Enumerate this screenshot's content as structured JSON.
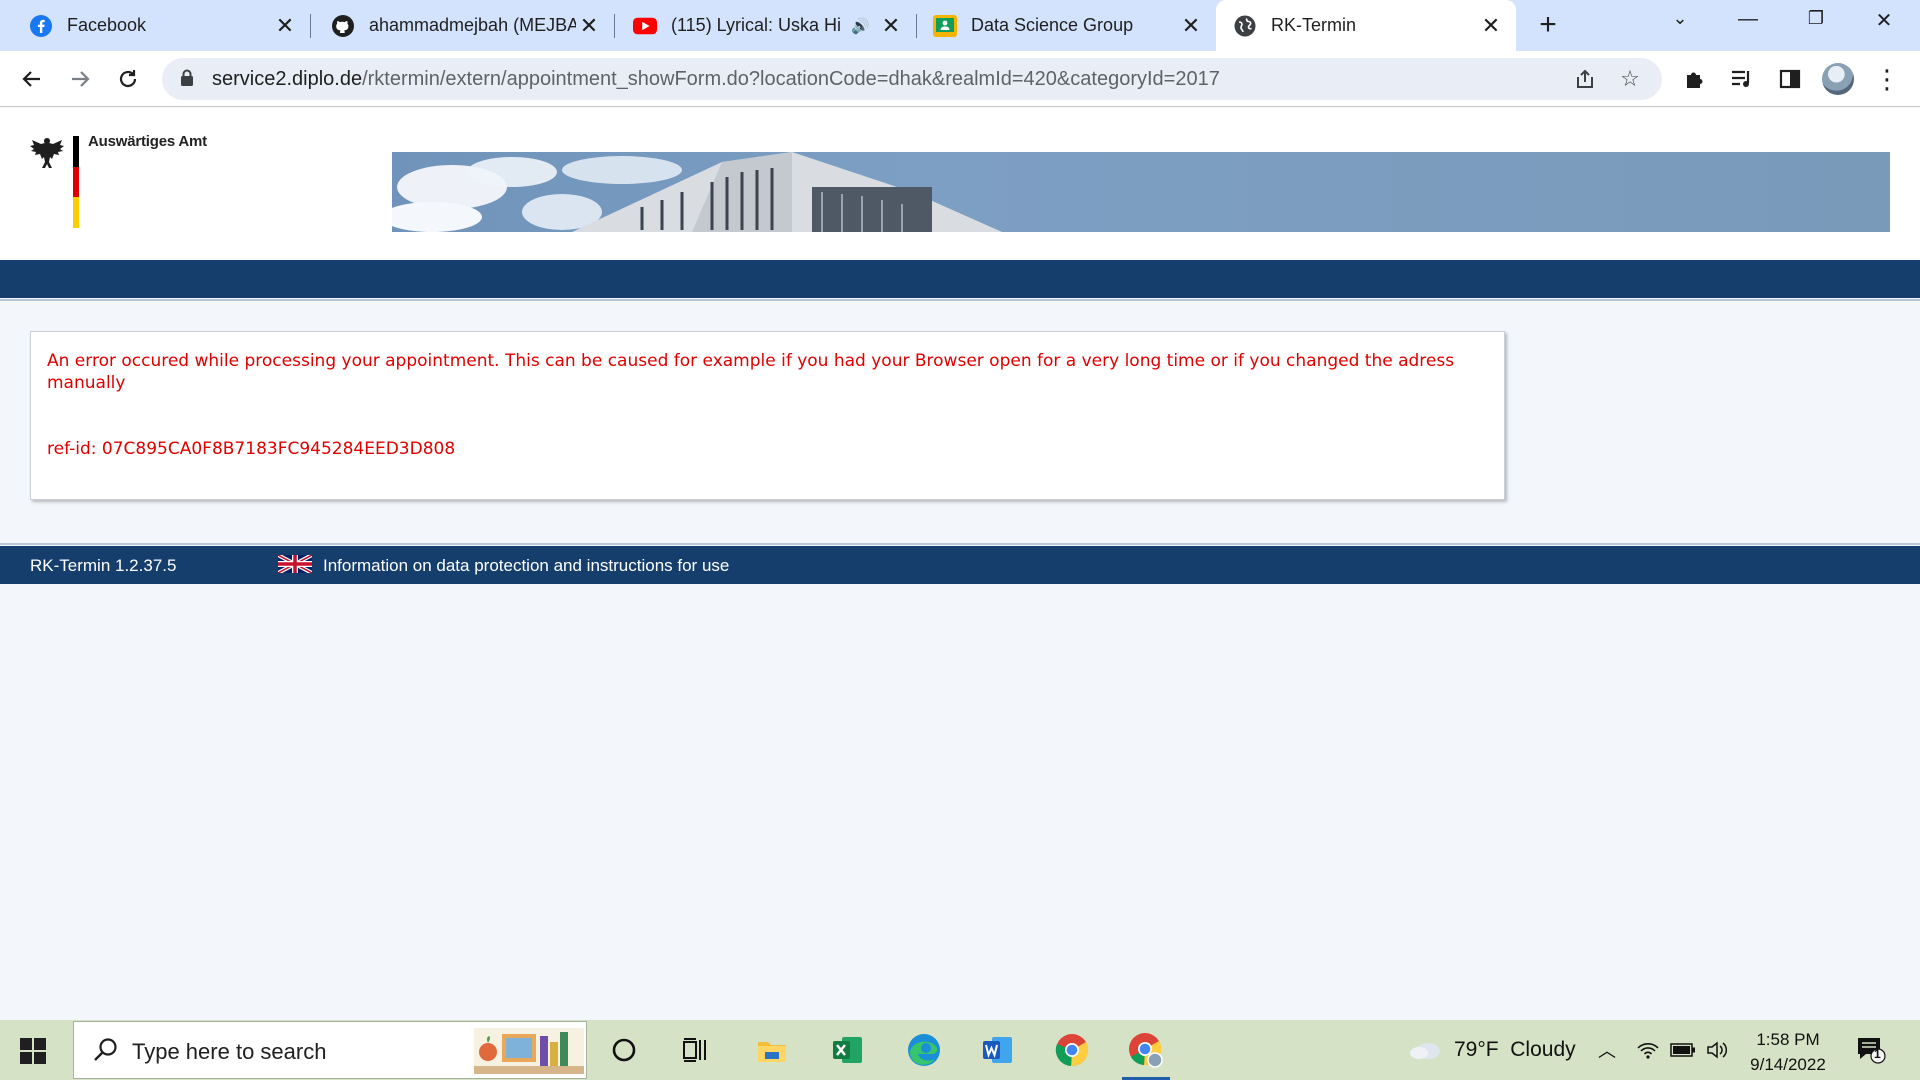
{
  "browser": {
    "tabs": [
      {
        "title": "Facebook",
        "icon": "facebook-icon"
      },
      {
        "title": "ahammadmejbah (MEJBA",
        "icon": "github-icon"
      },
      {
        "title": "(115) Lyrical: Uska Hi",
        "icon": "youtube-icon",
        "audio": true
      },
      {
        "title": "Data Science Group",
        "icon": "classroom-icon"
      },
      {
        "title": "RK-Termin",
        "icon": "globe-icon",
        "active": true
      }
    ],
    "url_host": "service2.diplo.de",
    "url_path": "/rktermin/extern/appointment_showForm.do?locationCode=dhak&realmId=420&categoryId=2017"
  },
  "page": {
    "brand": "Auswärtiges Amt",
    "error_message": "An error occured while processing your appointment. This can be caused for example if you had your Browser open for a very long time or if you changed the adress manually",
    "ref_id": "ref-id: 07C895CA0F8B7183FC945284EED3D808",
    "footer_version": "RK-Termin 1.2.37.5",
    "footer_info": "Information on data protection and instructions for use"
  },
  "taskbar": {
    "search_placeholder": "Type here to search",
    "weather": "79°F  Cloudy",
    "time": "1:58 PM",
    "date": "9/14/2022",
    "notifications": "1"
  },
  "colors": {
    "header_blue": "#153e6d",
    "error_red": "#e00000",
    "tab_strip": "#d3e3fd"
  }
}
